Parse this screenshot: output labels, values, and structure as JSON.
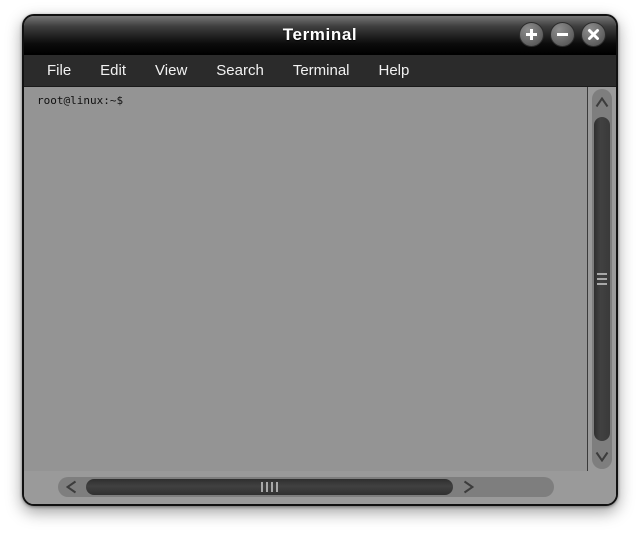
{
  "window": {
    "title": "Terminal",
    "controls": [
      {
        "name": "maximize-button",
        "glyph": "plus"
      },
      {
        "name": "minimize-button",
        "glyph": "minus"
      },
      {
        "name": "close-button",
        "glyph": "cross"
      }
    ]
  },
  "menubar": {
    "items": [
      {
        "label": "File"
      },
      {
        "label": "Edit"
      },
      {
        "label": "View"
      },
      {
        "label": "Search"
      },
      {
        "label": "Terminal"
      },
      {
        "label": "Help"
      }
    ]
  },
  "terminal": {
    "prompt": "root@linux:~$",
    "content": "root@linux:~$",
    "background_color": "#949494",
    "text_color": "#111111"
  },
  "scrollbars": {
    "vertical": {
      "up_arrow": "▲",
      "down_arrow": "▼",
      "thumb_grip_lines": 3
    },
    "horizontal": {
      "left_arrow": "◀",
      "right_arrow": "▶",
      "thumb_grip_lines": 4
    }
  },
  "colors": {
    "titlebar": "#000000",
    "menubar": "#2b2b2b",
    "frame": "#9a9a9a",
    "trough": "#7e7e7e",
    "thumb": "#3a3a3a",
    "border": "#111111"
  }
}
